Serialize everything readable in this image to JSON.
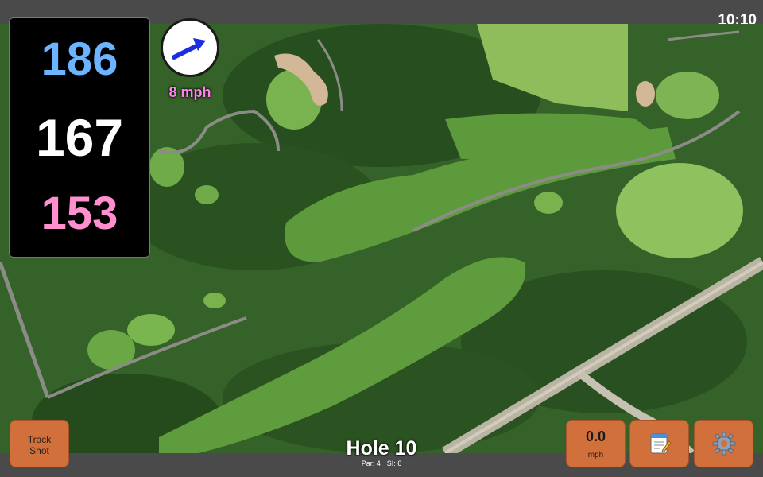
{
  "status": {
    "time": "10:10"
  },
  "distances": {
    "back": "186",
    "center": "167",
    "front": "153"
  },
  "wind": {
    "speed_label": "8 mph",
    "direction_icon": "arrow-icon"
  },
  "hole": {
    "title": "Hole 10",
    "par": "Par: 4",
    "si": "SI: 6"
  },
  "buttons": {
    "track_shot_line1": "Track",
    "track_shot_line2": "Shot",
    "wind_value": "0.0",
    "wind_unit": "mph",
    "notes_icon": "notepad-icon",
    "settings_icon": "gear-icon"
  },
  "colors": {
    "back": "#6cb4ff",
    "center": "#ffffff",
    "front": "#ff8fcf",
    "wind_text": "#ff80ee",
    "button": "#d2703b"
  }
}
